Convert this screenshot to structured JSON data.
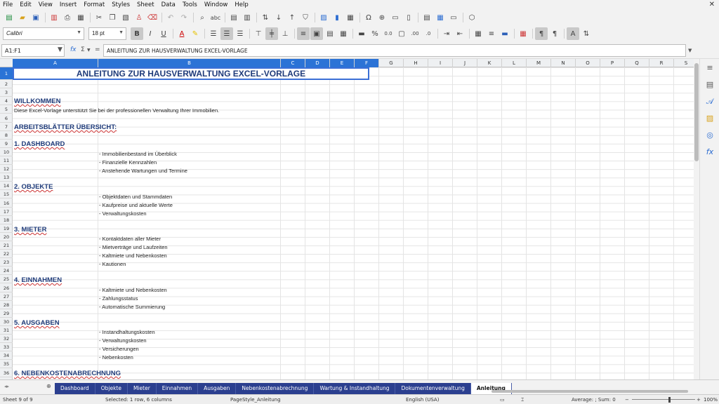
{
  "menu": [
    "File",
    "Edit",
    "View",
    "Insert",
    "Format",
    "Styles",
    "Sheet",
    "Data",
    "Tools",
    "Window",
    "Help"
  ],
  "close_glyph": "✕",
  "font": {
    "name": "Calibri",
    "size": "18 pt"
  },
  "formula": {
    "namebox": "A1:F1",
    "content": "ANLEITUNG ZUR HAUSVERWALTUNG EXCEL-VORLAGE"
  },
  "columns": [
    "A",
    "B",
    "C",
    "D",
    "E",
    "F",
    "G",
    "H",
    "I",
    "J",
    "K",
    "L",
    "M",
    "N",
    "O",
    "P",
    "Q",
    "R",
    "S"
  ],
  "rows": [
    "1",
    "2",
    "3",
    "4",
    "5",
    "6",
    "7",
    "8",
    "9",
    "10",
    "11",
    "12",
    "13",
    "14",
    "15",
    "16",
    "17",
    "18",
    "19",
    "20",
    "21",
    "22",
    "23",
    "24",
    "25",
    "26",
    "27",
    "28",
    "29",
    "30",
    "31",
    "32",
    "33",
    "34",
    "35",
    "36"
  ],
  "sheet": {
    "title": "ANLEITUNG ZUR HAUSVERWALTUNG EXCEL-VORLAGE",
    "welcome_heading": "WILLKOMMEN",
    "welcome_text": "Diese Excel-Vorlage unterstützt Sie bei der professionellen Verwaltung Ihrer Immobilien.",
    "overview_heading": "ARBEITSBLÄTTER ÜBERSICHT:",
    "sections": [
      {
        "heading": "1. DASHBOARD",
        "items": [
          "- Immobilienbestand im Überblick",
          "- Finanzielle Kennzahlen",
          "- Anstehende Wartungen und Termine"
        ]
      },
      {
        "heading": "2. OBJEKTE",
        "items": [
          "- Objektdaten und Stammdaten",
          "- Kaufpreise und aktuelle Werte",
          "- Verwaltungskosten"
        ]
      },
      {
        "heading": "3. MIETER",
        "items": [
          "- Kontaktdaten aller Mieter",
          "- Mietverträge und Laufzeiten",
          "- Kaltmiete und Nebenkosten",
          "- Kautionen"
        ]
      },
      {
        "heading": "4. EINNAHMEN",
        "items": [
          "- Kaltmiete und Nebenkosten",
          "- Zahlungsstatus",
          "- Automatische Summierung"
        ]
      },
      {
        "heading": "5. AUSGABEN",
        "items": [
          "- Instandhaltungskosten",
          "- Verwaltungskosten",
          "- Versicherungen",
          "- Nebenkosten"
        ]
      },
      {
        "heading": "6. NEBENKOSTENABRECHNUNG",
        "items": []
      }
    ]
  },
  "tabs": [
    "Dashboard",
    "Objekte",
    "Mieter",
    "Einnahmen",
    "Ausgaben",
    "Nebenkostenabrechnung",
    "Wartung & Instandhaltung",
    "Dokumentenverwaltung",
    "Anleitung"
  ],
  "active_tab": "Anleitung",
  "status": {
    "sheet": "Sheet 9 of 9",
    "selection": "Selected: 1 row, 6 columns",
    "pagestyle": "PageStyle_Anleitung",
    "language": "English (USA)",
    "sum": "Average: ; Sum: 0",
    "zoom": "100%"
  }
}
